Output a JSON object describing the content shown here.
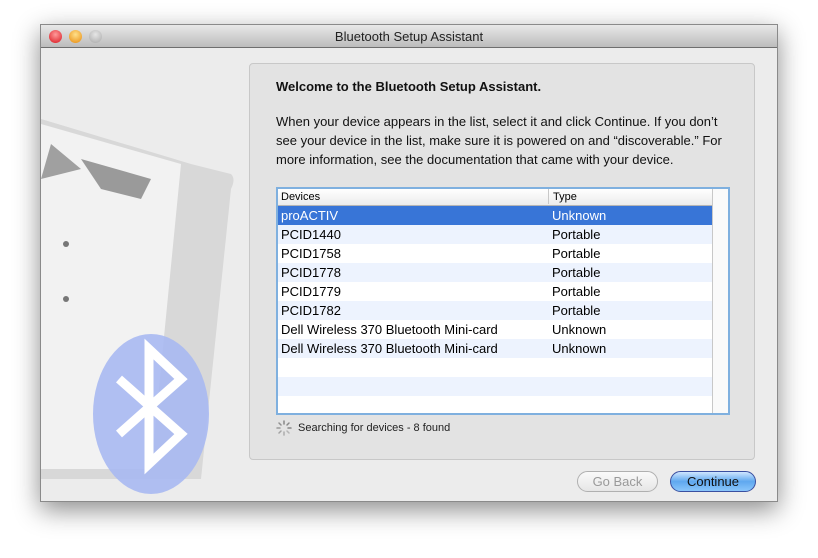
{
  "window": {
    "title": "Bluetooth Setup Assistant"
  },
  "heading": "Welcome to the Bluetooth Setup Assistant.",
  "instructions": "When your device appears in the list, select it and click Continue. If you don’t see your device in the list, make sure it is powered on and “discoverable.” For more information, see the documentation that came with your device.",
  "table": {
    "columns": [
      "Devices",
      "Type"
    ],
    "rows": [
      {
        "device": "proACTIV",
        "type": "Unknown"
      },
      {
        "device": "PCID1440",
        "type": "Portable"
      },
      {
        "device": "PCID1758",
        "type": "Portable"
      },
      {
        "device": "PCID1778",
        "type": "Portable"
      },
      {
        "device": "PCID1779",
        "type": "Portable"
      },
      {
        "device": "PCID1782",
        "type": "Portable"
      },
      {
        "device": "Dell Wireless 370 Bluetooth Mini-card",
        "type": "Unknown"
      },
      {
        "device": "Dell Wireless 370 Bluetooth Mini-card",
        "type": "Unknown"
      }
    ]
  },
  "status": "Searching for devices - 8 found",
  "buttons": {
    "back": "Go Back",
    "continue": "Continue"
  }
}
